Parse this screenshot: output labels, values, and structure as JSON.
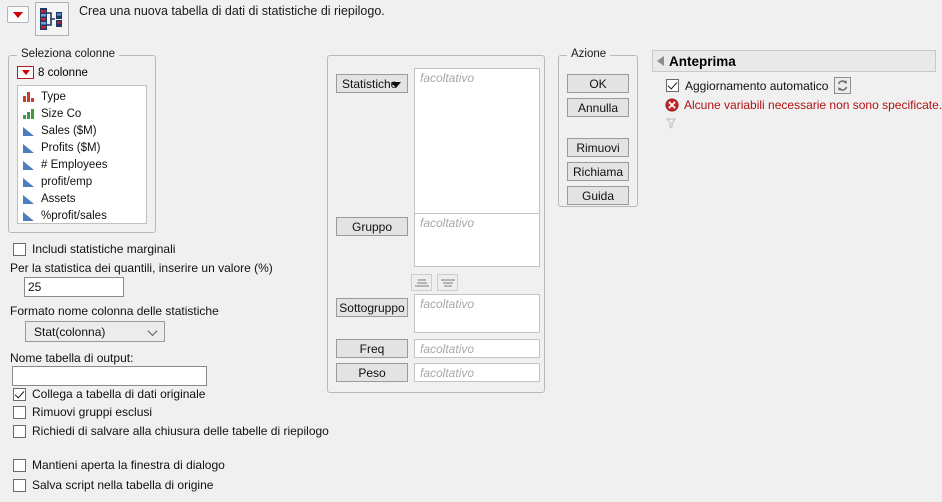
{
  "header": {
    "menu_button": "red-dropdown",
    "icon": "summary-table-icon",
    "title": "Crea una nuova tabella di dati di statistiche di riepilogo."
  },
  "select_columns": {
    "group_title": "Seleziona colonne",
    "dropdown_label": "8 colonne",
    "columns": [
      {
        "name": "Type",
        "type": "nominal"
      },
      {
        "name": "Size Co",
        "type": "ordinal"
      },
      {
        "name": "Sales ($M)",
        "type": "continuous"
      },
      {
        "name": "Profits ($M)",
        "type": "continuous"
      },
      {
        "name": "# Employees",
        "type": "continuous"
      },
      {
        "name": "profit/emp",
        "type": "continuous"
      },
      {
        "name": "Assets",
        "type": "continuous"
      },
      {
        "name": "%profit/sales",
        "type": "continuous"
      }
    ]
  },
  "options": {
    "marginal": {
      "label": "Includi statistiche marginali",
      "checked": false
    },
    "quantile_label": "Per la statistica dei quantili, inserire un valore (%)",
    "quantile_value": "25",
    "stat_format_label": "Formato nome colonna delle statistiche",
    "stat_format_value": "Stat(colonna)",
    "output_table_label": "Nome tabella di output:",
    "output_table_value": "",
    "link_original": {
      "label": "Collega a tabella di dati originale",
      "checked": true
    },
    "remove_excluded": {
      "label": "Rimuovi gruppi esclusi",
      "checked": false
    },
    "prompt_save": {
      "label": "Richiedi di salvare alla chiusura delle tabelle di riepilogo",
      "checked": false
    },
    "keep_open": {
      "label": "Mantieni aperta la finestra di dialogo",
      "checked": false
    },
    "save_script": {
      "label": "Salva script nella tabella di origine",
      "checked": false
    }
  },
  "roles": {
    "placeholder": "facoltativo",
    "statistiche_label": "Statistiche",
    "gruppo_label": "Gruppo",
    "sottogruppo_label": "Sottogruppo",
    "freq_label": "Freq",
    "peso_label": "Peso",
    "sort_asc": "sort-ascending-icon",
    "sort_desc": "sort-descending-icon"
  },
  "action": {
    "group_title": "Azione",
    "ok": "OK",
    "cancel": "Annulla",
    "remove": "Rimuovi",
    "recall": "Richiama",
    "help": "Guida"
  },
  "preview": {
    "title": "Anteprima",
    "auto_update": {
      "label": "Aggiornamento automatico",
      "checked": true
    },
    "refresh_icon": "refresh-icon",
    "error_icon": "error-icon",
    "error_message": "Alcune variabili necessarie non sono specificate.",
    "funnel_icon": "funnel-icon"
  },
  "colors": {
    "background": "#f0f0f0",
    "error_red": "#b11111",
    "nominal_red": "#d03b2b",
    "ordinal_green": "#3f9a42",
    "continuous_blue": "#4a7fbd",
    "button_face": "#e3e3e3"
  }
}
